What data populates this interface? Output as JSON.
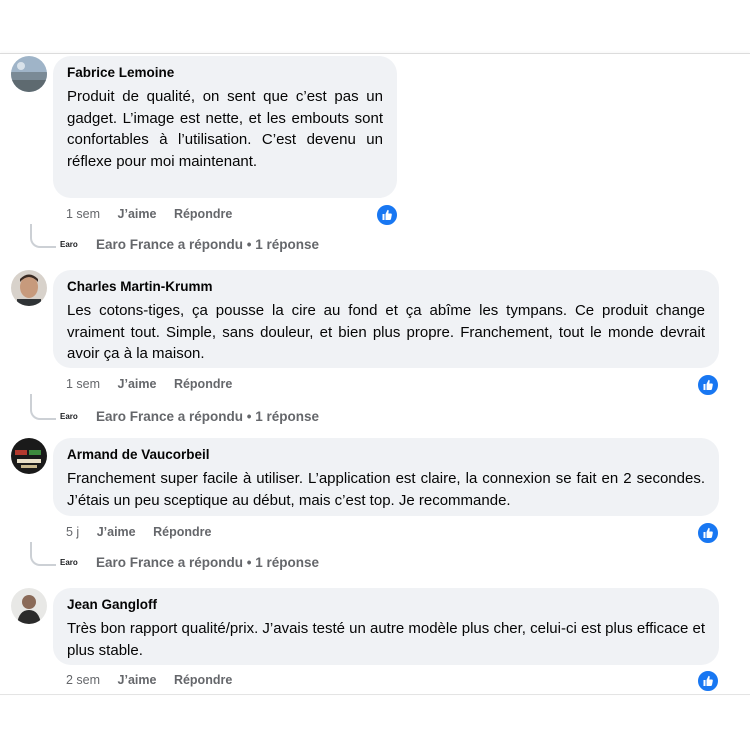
{
  "comments": [
    {
      "author": "Fabrice Lemoine",
      "text": "Produit de qualité, on sent que c’est pas un gadget. L’image est nette, et les embouts sont confortables à l’utilisation. C’est devenu un réflexe pour moi maintenant.",
      "time": "1 sem",
      "like": "J’aime",
      "reply": "Répondre",
      "reply_summary": "Earo France a répondu • 1 réponse"
    },
    {
      "author": "Charles Martin-Krumm",
      "text": "Les cotons-tiges, ça pousse la cire au fond et ça abîme les tympans. Ce produit change vraiment tout. Simple, sans douleur, et bien plus propre. Franchement, tout le monde devrait avoir ça à la maison.",
      "time": "1 sem",
      "like": "J’aime",
      "reply": "Répondre",
      "reply_summary": "Earo France a répondu • 1 réponse"
    },
    {
      "author": "Armand de Vaucorbeil",
      "text": "Franchement super facile à utiliser. L’application est claire, la connexion se fait en 2 secondes. J’étais un peu sceptique au début, mais c’est top. Je recommande.",
      "time": "5 j",
      "like": "J’aime",
      "reply": "Répondre",
      "reply_summary": "Earo France a répondu • 1 réponse"
    },
    {
      "author": "Jean Gangloff",
      "text": "Très bon rapport qualité/prix. J’avais testé un autre modèle plus cher, celui-ci est plus efficace et plus stable.",
      "time": "2 sem",
      "like": "J’aime",
      "reply": "Répondre"
    }
  ],
  "reply_logo": "Earo",
  "colors": {
    "like_blue": "#1877f2",
    "bubble": "#f0f2f5",
    "meta": "#65676b"
  }
}
